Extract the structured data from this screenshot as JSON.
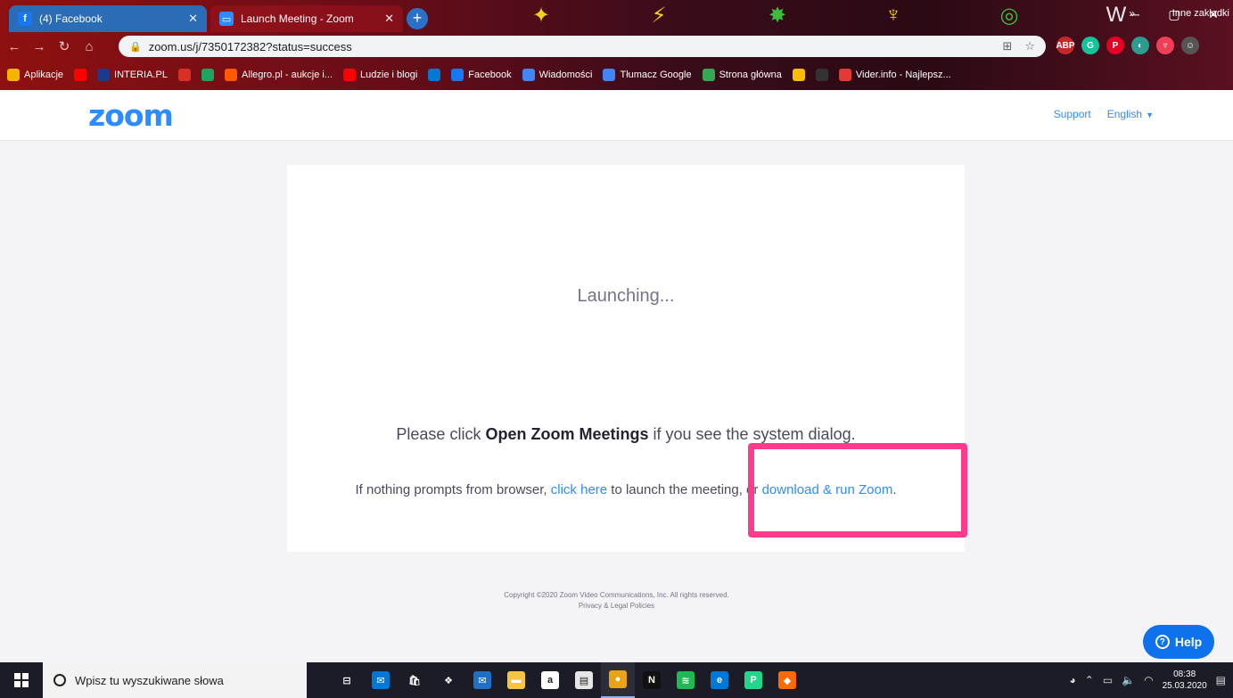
{
  "browser": {
    "tabs": [
      {
        "title": "(4) Facebook",
        "favicon": "f"
      },
      {
        "title": "Launch Meeting - Zoom",
        "favicon": "▭"
      }
    ],
    "url": "zoom.us/j/7350172382?status=success",
    "bookmarks": [
      {
        "label": "Aplikacje",
        "icon": "grid-icon",
        "color": "#f4b400"
      },
      {
        "label": "",
        "icon": "youtube-icon",
        "color": "#ff0000"
      },
      {
        "label": "INTERIA.PL",
        "icon": "interia-icon",
        "color": "#1b3a8c"
      },
      {
        "label": "",
        "icon": "image-icon",
        "color": "#d93025"
      },
      {
        "label": "",
        "icon": "drive-icon",
        "color": "#1fa463"
      },
      {
        "label": "Allegro.pl - aukcje i...",
        "icon": "allegro-icon",
        "color": "#ff5a00"
      },
      {
        "label": "Ludzie i blogi",
        "icon": "youtube-icon",
        "color": "#ff0000"
      },
      {
        "label": "",
        "icon": "outlook-icon",
        "color": "#0078d4"
      },
      {
        "label": "Facebook",
        "icon": "facebook-icon",
        "color": "#1877f2"
      },
      {
        "label": "Wiadomości",
        "icon": "google-icon",
        "color": "#4285f4"
      },
      {
        "label": "Tłumacz Google",
        "icon": "translate-icon",
        "color": "#4285f4"
      },
      {
        "label": "Strona główna",
        "icon": "home-icon",
        "color": "#34a853"
      },
      {
        "label": "",
        "icon": "chrome-icon",
        "color": "#fbbc05"
      },
      {
        "label": "",
        "icon": "shazam-icon",
        "color": "#333333"
      },
      {
        "label": "Vider.info - Najlepsz...",
        "icon": "vider-icon",
        "color": "#e53935"
      }
    ],
    "other_bookmarks": "Inne zakładki",
    "more_bookmarks": "»"
  },
  "zoom": {
    "logo": "zoom",
    "support": "Support",
    "language": "English",
    "launching": "Launching...",
    "open_prompt": {
      "prefix": "Please click ",
      "bold": "Open Zoom Meetings",
      "suffix": " if you see the system dialog."
    },
    "fallback": {
      "prefix": "If nothing prompts from browser, ",
      "click_here": "click here",
      "middle": " to launch the meeting, or ",
      "download": "download & run Zoom",
      "suffix": "."
    },
    "copyright": "Copyright ©2020 Zoom Video Communications, Inc. All rights reserved.",
    "legal": "Privacy & Legal Policies",
    "help": "Help"
  },
  "taskbar": {
    "search_placeholder": "Wpisz tu wyszukiwane słowa",
    "apps": [
      {
        "name": "task-view-icon",
        "glyph": "⊟",
        "color": "#1c1c26"
      },
      {
        "name": "outlook-app-icon",
        "glyph": "✉",
        "color": "#0078d4"
      },
      {
        "name": "store-icon",
        "glyph": "🛍",
        "color": "#1c1c26"
      },
      {
        "name": "dropbox-icon",
        "glyph": "❖",
        "color": "#1c1c26"
      },
      {
        "name": "mail-icon",
        "glyph": "✉",
        "color": "#1f6fc5"
      },
      {
        "name": "explorer-icon",
        "glyph": "▬",
        "color": "#f4c542"
      },
      {
        "name": "amazon-icon",
        "glyph": "a",
        "color": "#ffffff"
      },
      {
        "name": "notepad-icon",
        "glyph": "▤",
        "color": "#e6e6e6"
      },
      {
        "name": "chrome-app-icon",
        "glyph": "●",
        "color": "#e8a317"
      },
      {
        "name": "netflix-icon",
        "glyph": "N",
        "color": "#111111"
      },
      {
        "name": "spotify-icon",
        "glyph": "≋",
        "color": "#1db954"
      },
      {
        "name": "edge-icon",
        "glyph": "e",
        "color": "#0078d7"
      },
      {
        "name": "pycharm-icon",
        "glyph": "P",
        "color": "#21d789"
      },
      {
        "name": "app-orange-icon",
        "glyph": "◆",
        "color": "#ff6a00"
      }
    ],
    "time": "08:38",
    "date": "25.03.2020"
  }
}
